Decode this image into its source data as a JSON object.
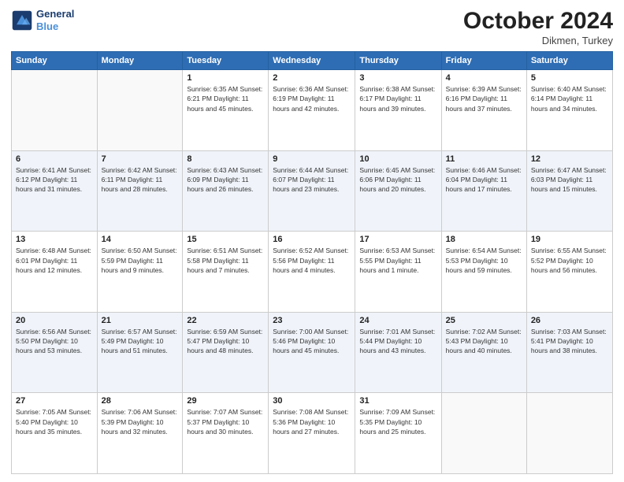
{
  "header": {
    "logo_line1": "General",
    "logo_line2": "Blue",
    "month": "October 2024",
    "location": "Dikmen, Turkey"
  },
  "days_of_week": [
    "Sunday",
    "Monday",
    "Tuesday",
    "Wednesday",
    "Thursday",
    "Friday",
    "Saturday"
  ],
  "weeks": [
    [
      {
        "day": "",
        "info": ""
      },
      {
        "day": "",
        "info": ""
      },
      {
        "day": "1",
        "info": "Sunrise: 6:35 AM\nSunset: 6:21 PM\nDaylight: 11 hours and 45 minutes."
      },
      {
        "day": "2",
        "info": "Sunrise: 6:36 AM\nSunset: 6:19 PM\nDaylight: 11 hours and 42 minutes."
      },
      {
        "day": "3",
        "info": "Sunrise: 6:38 AM\nSunset: 6:17 PM\nDaylight: 11 hours and 39 minutes."
      },
      {
        "day": "4",
        "info": "Sunrise: 6:39 AM\nSunset: 6:16 PM\nDaylight: 11 hours and 37 minutes."
      },
      {
        "day": "5",
        "info": "Sunrise: 6:40 AM\nSunset: 6:14 PM\nDaylight: 11 hours and 34 minutes."
      }
    ],
    [
      {
        "day": "6",
        "info": "Sunrise: 6:41 AM\nSunset: 6:12 PM\nDaylight: 11 hours and 31 minutes."
      },
      {
        "day": "7",
        "info": "Sunrise: 6:42 AM\nSunset: 6:11 PM\nDaylight: 11 hours and 28 minutes."
      },
      {
        "day": "8",
        "info": "Sunrise: 6:43 AM\nSunset: 6:09 PM\nDaylight: 11 hours and 26 minutes."
      },
      {
        "day": "9",
        "info": "Sunrise: 6:44 AM\nSunset: 6:07 PM\nDaylight: 11 hours and 23 minutes."
      },
      {
        "day": "10",
        "info": "Sunrise: 6:45 AM\nSunset: 6:06 PM\nDaylight: 11 hours and 20 minutes."
      },
      {
        "day": "11",
        "info": "Sunrise: 6:46 AM\nSunset: 6:04 PM\nDaylight: 11 hours and 17 minutes."
      },
      {
        "day": "12",
        "info": "Sunrise: 6:47 AM\nSunset: 6:03 PM\nDaylight: 11 hours and 15 minutes."
      }
    ],
    [
      {
        "day": "13",
        "info": "Sunrise: 6:48 AM\nSunset: 6:01 PM\nDaylight: 11 hours and 12 minutes."
      },
      {
        "day": "14",
        "info": "Sunrise: 6:50 AM\nSunset: 5:59 PM\nDaylight: 11 hours and 9 minutes."
      },
      {
        "day": "15",
        "info": "Sunrise: 6:51 AM\nSunset: 5:58 PM\nDaylight: 11 hours and 7 minutes."
      },
      {
        "day": "16",
        "info": "Sunrise: 6:52 AM\nSunset: 5:56 PM\nDaylight: 11 hours and 4 minutes."
      },
      {
        "day": "17",
        "info": "Sunrise: 6:53 AM\nSunset: 5:55 PM\nDaylight: 11 hours and 1 minute."
      },
      {
        "day": "18",
        "info": "Sunrise: 6:54 AM\nSunset: 5:53 PM\nDaylight: 10 hours and 59 minutes."
      },
      {
        "day": "19",
        "info": "Sunrise: 6:55 AM\nSunset: 5:52 PM\nDaylight: 10 hours and 56 minutes."
      }
    ],
    [
      {
        "day": "20",
        "info": "Sunrise: 6:56 AM\nSunset: 5:50 PM\nDaylight: 10 hours and 53 minutes."
      },
      {
        "day": "21",
        "info": "Sunrise: 6:57 AM\nSunset: 5:49 PM\nDaylight: 10 hours and 51 minutes."
      },
      {
        "day": "22",
        "info": "Sunrise: 6:59 AM\nSunset: 5:47 PM\nDaylight: 10 hours and 48 minutes."
      },
      {
        "day": "23",
        "info": "Sunrise: 7:00 AM\nSunset: 5:46 PM\nDaylight: 10 hours and 45 minutes."
      },
      {
        "day": "24",
        "info": "Sunrise: 7:01 AM\nSunset: 5:44 PM\nDaylight: 10 hours and 43 minutes."
      },
      {
        "day": "25",
        "info": "Sunrise: 7:02 AM\nSunset: 5:43 PM\nDaylight: 10 hours and 40 minutes."
      },
      {
        "day": "26",
        "info": "Sunrise: 7:03 AM\nSunset: 5:41 PM\nDaylight: 10 hours and 38 minutes."
      }
    ],
    [
      {
        "day": "27",
        "info": "Sunrise: 7:05 AM\nSunset: 5:40 PM\nDaylight: 10 hours and 35 minutes."
      },
      {
        "day": "28",
        "info": "Sunrise: 7:06 AM\nSunset: 5:39 PM\nDaylight: 10 hours and 32 minutes."
      },
      {
        "day": "29",
        "info": "Sunrise: 7:07 AM\nSunset: 5:37 PM\nDaylight: 10 hours and 30 minutes."
      },
      {
        "day": "30",
        "info": "Sunrise: 7:08 AM\nSunset: 5:36 PM\nDaylight: 10 hours and 27 minutes."
      },
      {
        "day": "31",
        "info": "Sunrise: 7:09 AM\nSunset: 5:35 PM\nDaylight: 10 hours and 25 minutes."
      },
      {
        "day": "",
        "info": ""
      },
      {
        "day": "",
        "info": ""
      }
    ]
  ]
}
